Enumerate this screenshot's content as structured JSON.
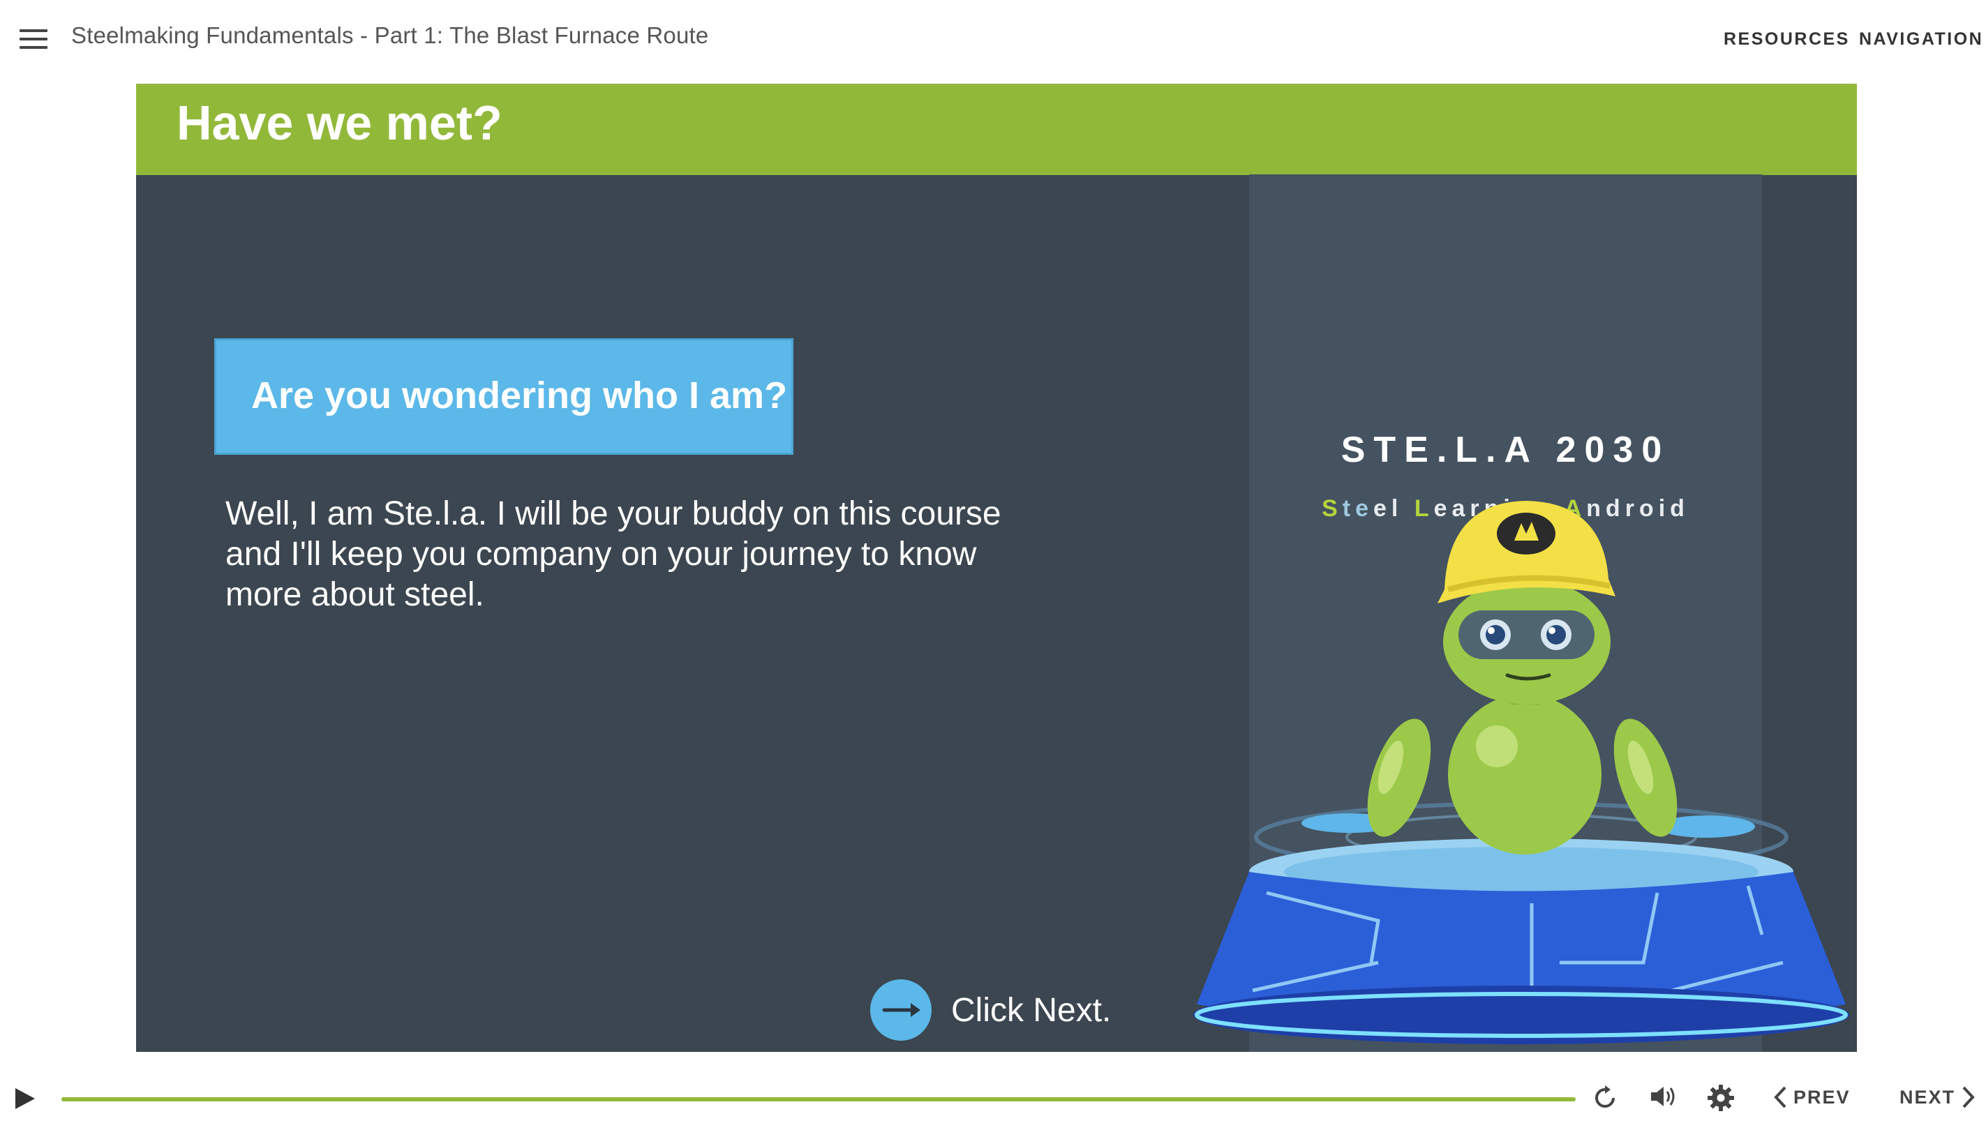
{
  "header": {
    "course_title": "Steelmaking Fundamentals - Part 1: The Blast Furnace Route",
    "resources_label": "RESOURCES",
    "navigation_label": "NAVIGATION",
    "menu_icon": "hamburger-menu-icon"
  },
  "slide": {
    "title": "Have we met?",
    "question": "Are you wondering who I am?",
    "intro": "Well, I am Ste.l.a. I will be your buddy on this course and I'll keep you company on your journey to know more about steel.",
    "click_next": "Click Next.",
    "brand_title": "STE.L.A 2030",
    "brand_subtitle": {
      "p1": "S",
      "p2": "te",
      "p3": "el ",
      "p4": "L",
      "p5": "earning ",
      "p6": "A",
      "p7": "ndroid"
    }
  },
  "controls": {
    "prev_label": "PREV",
    "next_label": "NEXT",
    "progress": 1.0,
    "icons": [
      "play-icon",
      "replay-icon",
      "volume-icon",
      "settings-icon",
      "chevron-left-icon",
      "chevron-right-icon"
    ]
  },
  "colors": {
    "header_green": "#92b83a",
    "slide_bg": "#3c4650",
    "accent_blue": "#5bb8e8",
    "robot_green": "#9cc94a",
    "helmet_yellow": "#f3e046"
  }
}
